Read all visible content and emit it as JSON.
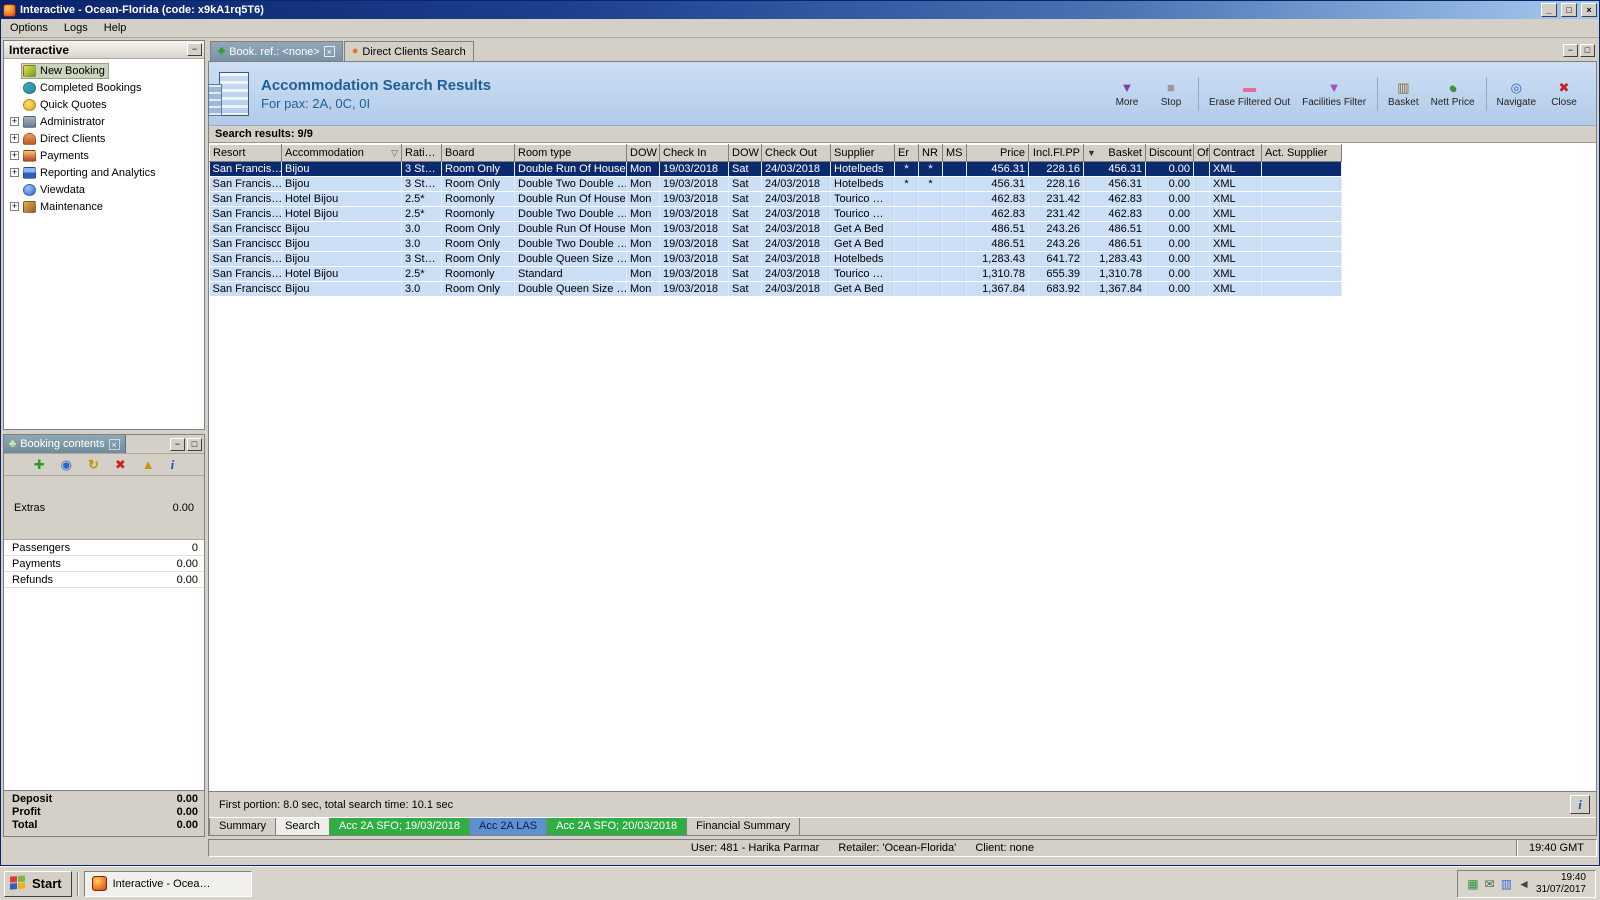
{
  "ui": {
    "minimize_glyph": "_",
    "maximize_glyph": "□",
    "close_glyph": "×",
    "collapse_glyph": "−",
    "restore_glyph": "□"
  },
  "window": {
    "title": "Interactive - Ocean-Florida (code: x9kA1rq5T6)",
    "menu_items": [
      "Options",
      "Logs",
      "Help"
    ]
  },
  "sidebar": {
    "title": "Interactive",
    "items": [
      {
        "label": "New Booking",
        "icon": "new-booking",
        "selected": true
      },
      {
        "label": "Completed Bookings",
        "icon": "completed-bookings"
      },
      {
        "label": "Quick Quotes",
        "icon": "quick-quotes"
      },
      {
        "label": "Administrator",
        "icon": "administrator",
        "expand": "+"
      },
      {
        "label": "Direct Clients",
        "icon": "direct-clients",
        "expand": "+"
      },
      {
        "label": "Payments",
        "icon": "payments",
        "expand": "+"
      },
      {
        "label": "Reporting and Analytics",
        "icon": "reporting",
        "expand": "+"
      },
      {
        "label": "Viewdata",
        "icon": "viewdata"
      },
      {
        "label": "Maintenance",
        "icon": "maintenance",
        "expand": "+"
      }
    ]
  },
  "booking_panel": {
    "title": "Booking contents",
    "tab_icon": "palm",
    "toolbar_icons": [
      {
        "icon": "add"
      },
      {
        "icon": "globe"
      },
      {
        "icon": "refresh"
      },
      {
        "icon": "delete"
      },
      {
        "icon": "up"
      },
      {
        "icon": "info"
      }
    ],
    "rows": [
      {
        "label": "Extras",
        "value": "0.00",
        "header": true
      },
      {
        "label": "Passengers",
        "value": "0"
      },
      {
        "label": "Payments",
        "value": "0.00"
      },
      {
        "label": "Refunds",
        "value": "0.00"
      }
    ],
    "totals": [
      {
        "label": "Deposit",
        "value": "0.00"
      },
      {
        "label": "Profit",
        "value": "0.00"
      },
      {
        "label": "Total",
        "value": "0.00"
      }
    ]
  },
  "doc_tabs": [
    {
      "label": "Book. ref.: <none>",
      "icon": "palm",
      "active": true,
      "closable": true
    },
    {
      "label": "Direct Clients Search",
      "icon": "search"
    }
  ],
  "header": {
    "title": "Accommodation Search Results",
    "subtitle": "For pax: 2A, 0C, 0I",
    "buttons": [
      {
        "label": "More",
        "icon": "more"
      },
      {
        "label": "Stop",
        "icon": "stop"
      },
      {
        "label": "Erase Filtered Out",
        "icon": "erase",
        "sep_before": true
      },
      {
        "label": "Facilities Filter",
        "icon": "filter"
      },
      {
        "label": "Basket",
        "icon": "basket",
        "sep_before": true
      },
      {
        "label": "Nett Price",
        "icon": "nett"
      },
      {
        "label": "Navigate",
        "icon": "navigate",
        "sep_before": true
      },
      {
        "label": "Close",
        "icon": "close"
      }
    ]
  },
  "results": {
    "summary": "Search results: 9/9",
    "columns": [
      {
        "label": "Resort"
      },
      {
        "label": "Accommodation",
        "filter": true
      },
      {
        "label": "Rati…"
      },
      {
        "label": "Board"
      },
      {
        "label": "Room type"
      },
      {
        "label": "DOW"
      },
      {
        "label": "Check In"
      },
      {
        "label": "DOW"
      },
      {
        "label": "Check Out"
      },
      {
        "label": "Supplier"
      },
      {
        "label": "Er"
      },
      {
        "label": "NR"
      },
      {
        "label": "MS"
      },
      {
        "label": "Price",
        "num": true
      },
      {
        "label": "Incl.Fl.PP",
        "num": true
      },
      {
        "label": "Basket",
        "num": true,
        "sort": true
      },
      {
        "label": "Discount",
        "num": true
      },
      {
        "label": "Of"
      },
      {
        "label": "Contract"
      },
      {
        "label": "Act. Supplier"
      }
    ],
    "rows": [
      {
        "selected": true,
        "cells": [
          "San Francis…",
          "Bijou",
          "3 St…",
          "Room Only",
          "Double Run Of House",
          "Mon",
          "19/03/2018",
          "Sat",
          "24/03/2018",
          "Hotelbeds",
          "*",
          "*",
          "",
          "456.31",
          "228.16",
          "456.31",
          "0.00",
          "",
          "XML",
          ""
        ]
      },
      {
        "cells": [
          "San Francis…",
          "Bijou",
          "3 St…",
          "Room Only",
          "Double Two Double …",
          "Mon",
          "19/03/2018",
          "Sat",
          "24/03/2018",
          "Hotelbeds",
          "*",
          "*",
          "",
          "456.31",
          "228.16",
          "456.31",
          "0.00",
          "",
          "XML",
          ""
        ]
      },
      {
        "cells": [
          "San Francis…",
          "Hotel Bijou",
          "2.5*",
          "Roomonly",
          "Double Run Of House",
          "Mon",
          "19/03/2018",
          "Sat",
          "24/03/2018",
          "Tourico …",
          "",
          "",
          "",
          "462.83",
          "231.42",
          "462.83",
          "0.00",
          "",
          "XML",
          ""
        ]
      },
      {
        "cells": [
          "San Francis…",
          "Hotel Bijou",
          "2.5*",
          "Roomonly",
          "Double Two Double …",
          "Mon",
          "19/03/2018",
          "Sat",
          "24/03/2018",
          "Tourico …",
          "",
          "",
          "",
          "462.83",
          "231.42",
          "462.83",
          "0.00",
          "",
          "XML",
          ""
        ]
      },
      {
        "cells": [
          "San Francisco",
          "Bijou",
          "3.0",
          "Room Only",
          "Double Run Of House",
          "Mon",
          "19/03/2018",
          "Sat",
          "24/03/2018",
          "Get A Bed",
          "",
          "",
          "",
          "486.51",
          "243.26",
          "486.51",
          "0.00",
          "",
          "XML",
          ""
        ]
      },
      {
        "cells": [
          "San Francisco",
          "Bijou",
          "3.0",
          "Room Only",
          "Double Two Double …",
          "Mon",
          "19/03/2018",
          "Sat",
          "24/03/2018",
          "Get A Bed",
          "",
          "",
          "",
          "486.51",
          "243.26",
          "486.51",
          "0.00",
          "",
          "XML",
          ""
        ]
      },
      {
        "cells": [
          "San Francis…",
          "Bijou",
          "3 St…",
          "Room Only",
          "Double Queen Size …",
          "Mon",
          "19/03/2018",
          "Sat",
          "24/03/2018",
          "Hotelbeds",
          "",
          "",
          "",
          "1,283.43",
          "641.72",
          "1,283.43",
          "0.00",
          "",
          "XML",
          ""
        ]
      },
      {
        "cells": [
          "San Francis…",
          "Hotel Bijou",
          "2.5*",
          "Roomonly",
          "Standard",
          "Mon",
          "19/03/2018",
          "Sat",
          "24/03/2018",
          "Tourico …",
          "",
          "",
          "",
          "1,310.78",
          "655.39",
          "1,310.78",
          "0.00",
          "",
          "XML",
          ""
        ]
      },
      {
        "cells": [
          "San Francisco",
          "Bijou",
          "3.0",
          "Room Only",
          "Double Queen Size …",
          "Mon",
          "19/03/2018",
          "Sat",
          "24/03/2018",
          "Get A Bed",
          "",
          "",
          "",
          "1,367.84",
          "683.92",
          "1,367.84",
          "0.00",
          "",
          "XML",
          ""
        ]
      }
    ]
  },
  "status": {
    "timing": "First portion: 8.0 sec, total search time: 10.1 sec",
    "info_glyph": "i"
  },
  "bottom_tabs": [
    {
      "label": "Summary"
    },
    {
      "label": "Search",
      "active": true
    },
    {
      "label": "Acc 2A SFO; 19/03/2018",
      "style": "green"
    },
    {
      "label": "Acc 2A LAS",
      "style": "blue"
    },
    {
      "label": "Acc 2A SFO; 20/03/2018",
      "style": "green"
    },
    {
      "label": "Financial Summary"
    }
  ],
  "statusbar": {
    "user": "User: 481 - Harika Parmar",
    "retailer": "Retailer: 'Ocean-Florida'",
    "client": "Client: none",
    "time": "19:40 GMT"
  },
  "taskbar": {
    "start_label": "Start",
    "task_label": "Interactive - Ocea…",
    "tray_icons": [
      {
        "icon": "network"
      },
      {
        "icon": "mail"
      },
      {
        "icon": "display"
      },
      {
        "icon": "volume"
      }
    ],
    "tray_time": "19:40",
    "tray_date": "31/07/2017"
  }
}
